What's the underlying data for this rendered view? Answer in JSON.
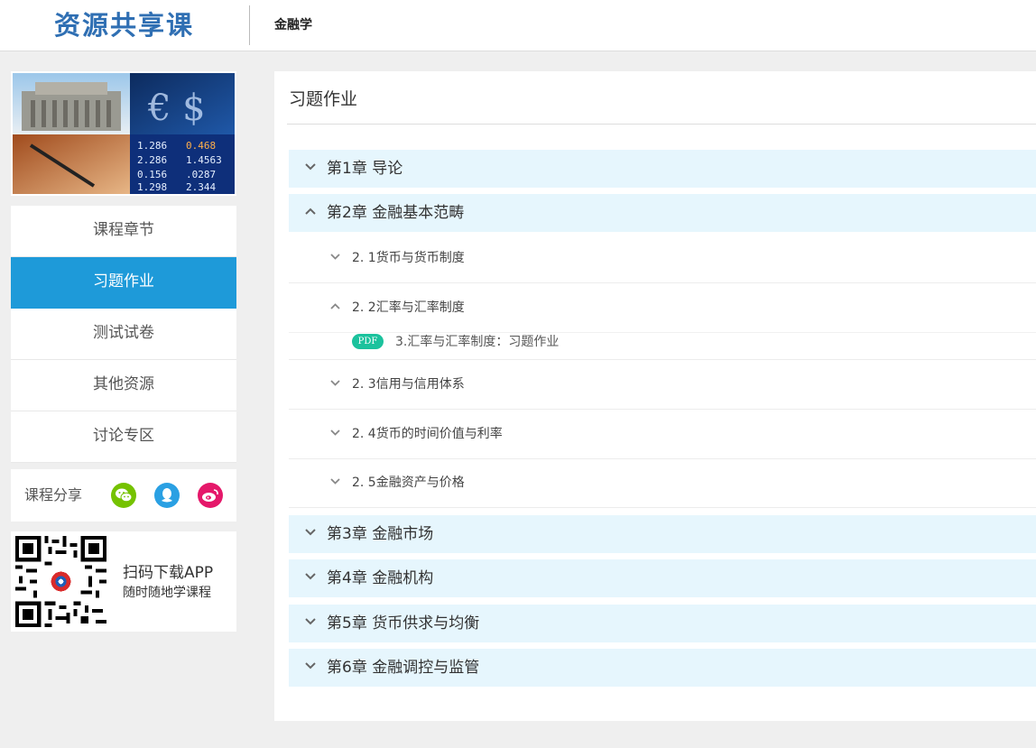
{
  "header": {
    "brand": "资源共享课",
    "course_name": "金融学"
  },
  "sidebar": {
    "menu": [
      {
        "label": "课程章节",
        "active": false
      },
      {
        "label": "习题作业",
        "active": true
      },
      {
        "label": "测试试卷",
        "active": false
      },
      {
        "label": "其他资源",
        "active": false
      },
      {
        "label": "讨论专区",
        "active": false
      }
    ],
    "share_label": "课程分享",
    "share_icons": [
      "wechat-icon",
      "qq-icon",
      "weibo-icon"
    ],
    "app_title": "扫码下载APP",
    "app_subtitle": "随时随地学课程"
  },
  "main": {
    "title": "习题作业",
    "chapters": [
      {
        "label": "第1章 导论",
        "expanded": false
      },
      {
        "label": "第2章 金融基本范畴",
        "expanded": true
      },
      {
        "label": "第3章 金融市场",
        "expanded": false
      },
      {
        "label": "第4章 金融机构",
        "expanded": false
      },
      {
        "label": "第5章 货币供求与均衡",
        "expanded": false
      },
      {
        "label": "第6章 金融调控与监管",
        "expanded": false
      }
    ],
    "sections": [
      {
        "label": "2. 1货币与货币制度",
        "expanded": false
      },
      {
        "label": "2. 2汇率与汇率制度",
        "expanded": true
      },
      {
        "label": "2. 3信用与信用体系",
        "expanded": false
      },
      {
        "label": "2. 4货币的时间价值与利率",
        "expanded": false
      },
      {
        "label": "2. 5金融资产与价格",
        "expanded": false
      }
    ],
    "resource": {
      "badge": "PDF",
      "label": "3.汇率与汇率制度：习题作业"
    }
  },
  "colors": {
    "accent": "#1e9ad9",
    "brand": "#2f6fb3",
    "chapter_bg": "#e6f6fd",
    "pdf_badge": "#1bc29d"
  }
}
